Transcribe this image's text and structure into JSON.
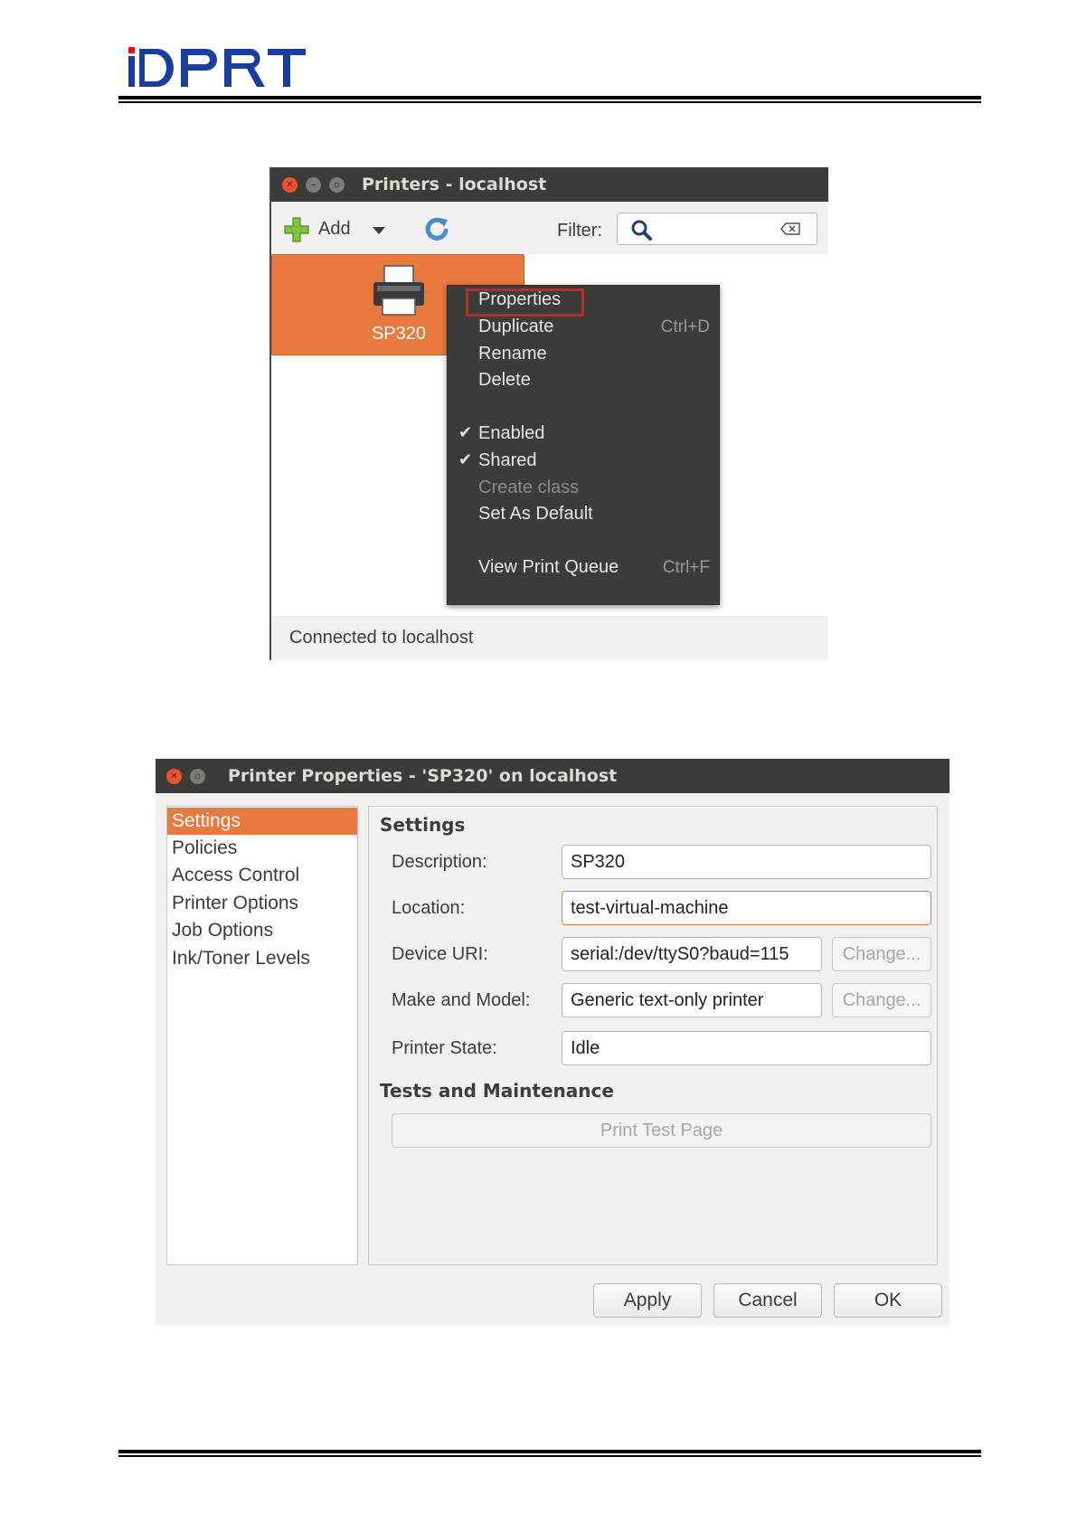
{
  "brand": {
    "logo_text": "iDPRT",
    "color": "#1a3f9a",
    "accent": "#d9161c"
  },
  "printers_window": {
    "title": "Printers - localhost",
    "toolbar": {
      "add_label": "Add",
      "filter_label": "Filter:",
      "filter_value": ""
    },
    "printer": {
      "name": "SP320"
    },
    "status": "Connected to localhost",
    "context_menu": {
      "properties": "Properties",
      "duplicate": "Duplicate",
      "duplicate_shortcut": "Ctrl+D",
      "rename": "Rename",
      "delete": "Delete",
      "enabled": "Enabled",
      "shared": "Shared",
      "create_class": "Create class",
      "set_default": "Set As Default",
      "view_queue": "View Print Queue",
      "view_queue_shortcut": "Ctrl+F"
    }
  },
  "properties_window": {
    "title": "Printer Properties - 'SP320' on localhost",
    "sidebar": [
      "Settings",
      "Policies",
      "Access Control",
      "Printer Options",
      "Job Options",
      "Ink/Toner Levels"
    ],
    "settings_heading": "Settings",
    "labels": {
      "description": "Description:",
      "location": "Location:",
      "device_uri": "Device URI:",
      "make_model": "Make and Model:",
      "state": "Printer State:"
    },
    "values": {
      "description": "SP320",
      "location": "test-virtual-machine",
      "device_uri": "serial:/dev/ttyS0?baud=115",
      "make_model": "Generic text-only printer",
      "state": "Idle"
    },
    "change_label": "Change...",
    "tests_heading": "Tests and Maintenance",
    "print_test_label": "Print Test Page",
    "buttons": {
      "apply": "Apply",
      "cancel": "Cancel",
      "ok": "OK"
    }
  },
  "colors": {
    "accent": "#e87a3f",
    "titlebar": "#3c3b37",
    "highlight_box": "#d61d28"
  }
}
